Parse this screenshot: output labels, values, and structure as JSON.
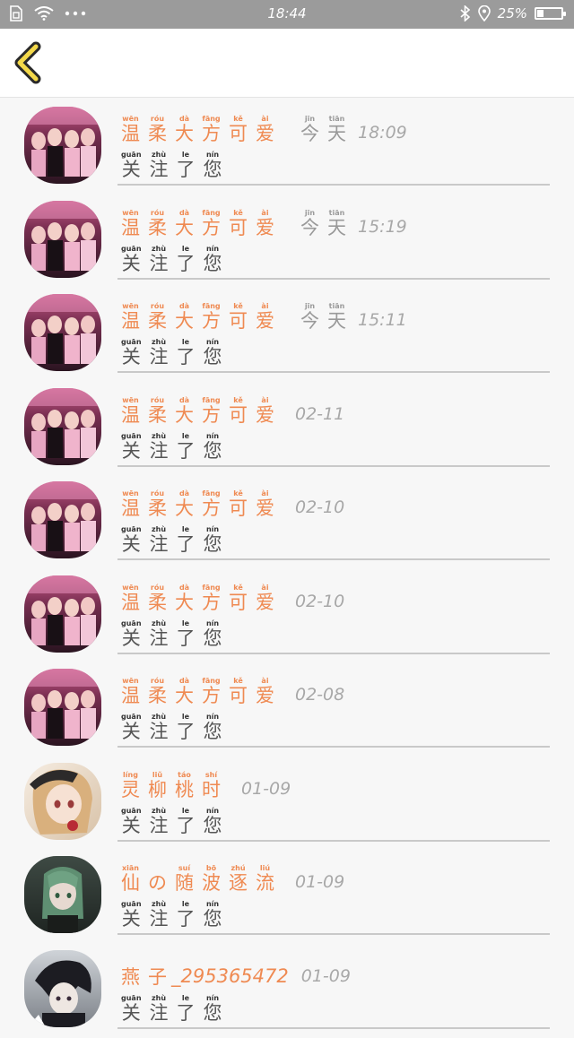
{
  "status_bar": {
    "time": "18:44",
    "battery": "25%",
    "battery_level": 0.25,
    "left_icons": [
      "sim-icon",
      "wifi-icon",
      "more-dots-icon"
    ],
    "right_icons": [
      "bluetooth-icon",
      "location-icon",
      "battery-icon"
    ]
  },
  "colors": {
    "name": "#ef8a52",
    "time": "#a8a8a8",
    "back_arrow_fill": "#f4d94a",
    "status_bar": "#9b9b9b"
  },
  "items": [
    {
      "avatar": "group-photo-avatar",
      "name": [
        [
          "wēn",
          "温"
        ],
        [
          "róu",
          "柔"
        ],
        [
          "dà",
          "大"
        ],
        [
          "fāng",
          "方"
        ],
        [
          "kě",
          "可"
        ],
        [
          "ài",
          "爱"
        ]
      ],
      "name_tail": "",
      "time_prefix": [
        [
          "jīn",
          "今"
        ],
        [
          "tiān",
          "天"
        ]
      ],
      "time": "18:09",
      "action": [
        [
          "guān",
          "关"
        ],
        [
          "zhù",
          "注"
        ],
        [
          "le",
          "了"
        ],
        [
          "nín",
          "您"
        ]
      ]
    },
    {
      "avatar": "group-photo-avatar",
      "name": [
        [
          "wēn",
          "温"
        ],
        [
          "róu",
          "柔"
        ],
        [
          "dà",
          "大"
        ],
        [
          "fāng",
          "方"
        ],
        [
          "kě",
          "可"
        ],
        [
          "ài",
          "爱"
        ]
      ],
      "name_tail": "",
      "time_prefix": [
        [
          "jīn",
          "今"
        ],
        [
          "tiān",
          "天"
        ]
      ],
      "time": "15:19",
      "action": [
        [
          "guān",
          "关"
        ],
        [
          "zhù",
          "注"
        ],
        [
          "le",
          "了"
        ],
        [
          "nín",
          "您"
        ]
      ]
    },
    {
      "avatar": "group-photo-avatar",
      "name": [
        [
          "wēn",
          "温"
        ],
        [
          "róu",
          "柔"
        ],
        [
          "dà",
          "大"
        ],
        [
          "fāng",
          "方"
        ],
        [
          "kě",
          "可"
        ],
        [
          "ài",
          "爱"
        ]
      ],
      "name_tail": "",
      "time_prefix": [
        [
          "jīn",
          "今"
        ],
        [
          "tiān",
          "天"
        ]
      ],
      "time": "15:11",
      "action": [
        [
          "guān",
          "关"
        ],
        [
          "zhù",
          "注"
        ],
        [
          "le",
          "了"
        ],
        [
          "nín",
          "您"
        ]
      ]
    },
    {
      "avatar": "group-photo-avatar",
      "name": [
        [
          "wēn",
          "温"
        ],
        [
          "róu",
          "柔"
        ],
        [
          "dà",
          "大"
        ],
        [
          "fāng",
          "方"
        ],
        [
          "kě",
          "可"
        ],
        [
          "ài",
          "爱"
        ]
      ],
      "name_tail": "",
      "time_prefix": [],
      "time": "02-11",
      "action": [
        [
          "guān",
          "关"
        ],
        [
          "zhù",
          "注"
        ],
        [
          "le",
          "了"
        ],
        [
          "nín",
          "您"
        ]
      ]
    },
    {
      "avatar": "group-photo-avatar",
      "name": [
        [
          "wēn",
          "温"
        ],
        [
          "róu",
          "柔"
        ],
        [
          "dà",
          "大"
        ],
        [
          "fāng",
          "方"
        ],
        [
          "kě",
          "可"
        ],
        [
          "ài",
          "爱"
        ]
      ],
      "name_tail": "",
      "time_prefix": [],
      "time": "02-10",
      "action": [
        [
          "guān",
          "关"
        ],
        [
          "zhù",
          "注"
        ],
        [
          "le",
          "了"
        ],
        [
          "nín",
          "您"
        ]
      ]
    },
    {
      "avatar": "group-photo-avatar",
      "name": [
        [
          "wēn",
          "温"
        ],
        [
          "róu",
          "柔"
        ],
        [
          "dà",
          "大"
        ],
        [
          "fāng",
          "方"
        ],
        [
          "kě",
          "可"
        ],
        [
          "ài",
          "爱"
        ]
      ],
      "name_tail": "",
      "time_prefix": [],
      "time": "02-10",
      "action": [
        [
          "guān",
          "关"
        ],
        [
          "zhù",
          "注"
        ],
        [
          "le",
          "了"
        ],
        [
          "nín",
          "您"
        ]
      ]
    },
    {
      "avatar": "group-photo-avatar",
      "name": [
        [
          "wēn",
          "温"
        ],
        [
          "róu",
          "柔"
        ],
        [
          "dà",
          "大"
        ],
        [
          "fāng",
          "方"
        ],
        [
          "kě",
          "可"
        ],
        [
          "ài",
          "爱"
        ]
      ],
      "name_tail": "",
      "time_prefix": [],
      "time": "02-08",
      "action": [
        [
          "guān",
          "关"
        ],
        [
          "zhù",
          "注"
        ],
        [
          "le",
          "了"
        ],
        [
          "nín",
          "您"
        ]
      ]
    },
    {
      "avatar": "anime-girl-avatar",
      "name": [
        [
          "líng",
          "灵"
        ],
        [
          "liǔ",
          "柳"
        ],
        [
          "táo",
          "桃"
        ],
        [
          "shí",
          "时"
        ]
      ],
      "name_tail": "",
      "time_prefix": [],
      "time": "01-09",
      "action": [
        [
          "guān",
          "关"
        ],
        [
          "zhù",
          "注"
        ],
        [
          "le",
          "了"
        ],
        [
          "nín",
          "您"
        ]
      ]
    },
    {
      "avatar": "anime-green-hair-avatar",
      "name": [
        [
          "xiān",
          "仙"
        ],
        [
          "",
          "の"
        ],
        [
          "suí",
          "随"
        ],
        [
          "bō",
          "波"
        ],
        [
          "zhú",
          "逐"
        ],
        [
          "liú",
          "流"
        ]
      ],
      "name_tail": "",
      "time_prefix": [],
      "time": "01-09",
      "action": [
        [
          "guān",
          "关"
        ],
        [
          "zhù",
          "注"
        ],
        [
          "le",
          "了"
        ],
        [
          "nín",
          "您"
        ]
      ]
    },
    {
      "avatar": "anime-boy-avatar",
      "name": [
        [
          "",
          "燕"
        ],
        [
          "",
          "子"
        ]
      ],
      "name_tail": "_295365472",
      "time_prefix": [],
      "time": "01-09",
      "action": [
        [
          "guān",
          "关"
        ],
        [
          "zhù",
          "注"
        ],
        [
          "le",
          "了"
        ],
        [
          "nín",
          "您"
        ]
      ]
    }
  ]
}
